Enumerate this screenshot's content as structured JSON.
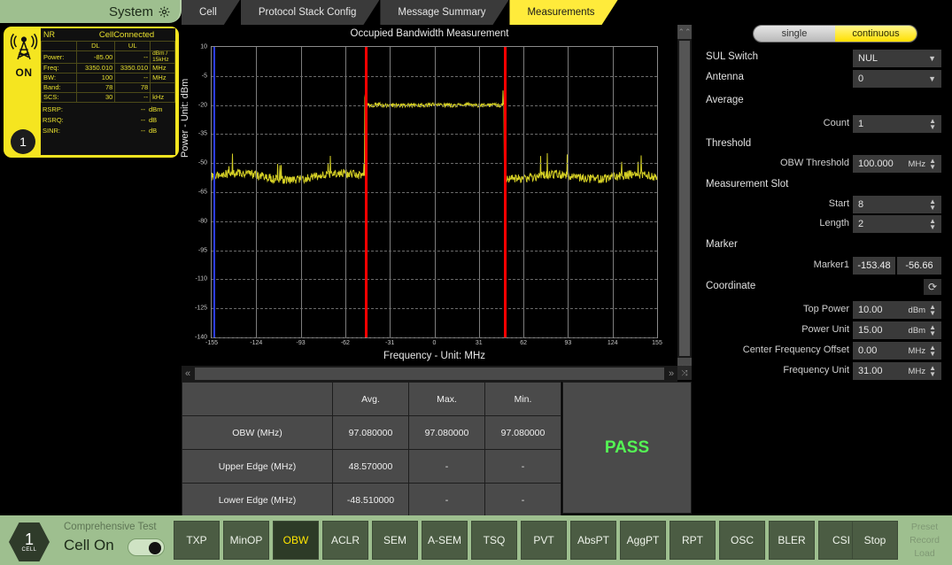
{
  "topbar": {
    "system_label": "System",
    "system_icon": "gear-icon",
    "tabs": [
      {
        "label": "Cell",
        "selected": false
      },
      {
        "label": "Protocol Stack Config",
        "selected": false
      },
      {
        "label": "Message Summary",
        "selected": false
      },
      {
        "label": "Measurements",
        "selected": true
      }
    ]
  },
  "nr_card": {
    "tower_icon": "cell-tower-icon",
    "on_label": "ON",
    "badge": "1",
    "tech": "NR",
    "state": "CellConnected",
    "col_dl": "DL",
    "col_ul": "UL",
    "rows": [
      {
        "name": "Power:",
        "dl": "-85.00",
        "ul": "--",
        "unit": "dBm / 15kHz"
      },
      {
        "name": "Freq:",
        "dl": "3350.010",
        "ul": "3350.010",
        "unit": "MHz"
      },
      {
        "name": "BW:",
        "dl": "100",
        "ul": "--",
        "unit": "MHz"
      },
      {
        "name": "Band:",
        "dl": "78",
        "ul": "78",
        "unit": ""
      },
      {
        "name": "SCS:",
        "dl": "30",
        "ul": "--",
        "unit": "kHz"
      }
    ],
    "footer": [
      {
        "name": "RSRP:",
        "value": "--",
        "unit": "dBm"
      },
      {
        "name": "RSRQ:",
        "value": "--",
        "unit": "dB"
      },
      {
        "name": "SINR:",
        "value": "--",
        "unit": "dB"
      }
    ]
  },
  "chart_data": {
    "type": "line",
    "title": "Occupied Bandwidth Measurement",
    "xlabel": "Frequency - Unit: MHz",
    "ylabel": "Power - Unit: dBm",
    "xlim": [
      -155,
      155
    ],
    "ylim": [
      -140,
      10
    ],
    "xticks": [
      -155,
      -124,
      -93,
      -62,
      -31,
      0,
      31,
      62,
      93,
      124,
      155
    ],
    "yticks": [
      10,
      -5,
      -20,
      -35,
      -50,
      -65,
      -80,
      -95,
      -110,
      -125,
      -140
    ],
    "grid": true,
    "legend": "none",
    "trace_color": "#d4cf25",
    "markers": [
      {
        "name": "lower-edge-marker",
        "x": -48.51,
        "color": "#ff0000"
      },
      {
        "name": "upper-edge-marker",
        "x": 48.57,
        "color": "#ff0000"
      },
      {
        "name": "marker1",
        "x": -153.48,
        "y": -56.66,
        "color": "#2b3cf0"
      }
    ],
    "series": [
      {
        "name": "Spectrum",
        "description": "Noise floor near -57 dBm outside band, flat in-band plateau near -20 dBm between -48.51 and 48.57 MHz",
        "noise_floor_dbm": -57,
        "in_band_dbm": -20,
        "band_start_mhz": -48.51,
        "band_stop_mhz": 48.57
      }
    ]
  },
  "results_table": {
    "headers": [
      "",
      "Avg.",
      "Max.",
      "Min."
    ],
    "rows": [
      {
        "label": "OBW (MHz)",
        "avg": "97.080000",
        "max": "97.080000",
        "min": "97.080000"
      },
      {
        "label": "Upper Edge (MHz)",
        "avg": "48.570000",
        "max": "-",
        "min": "-"
      },
      {
        "label": "Lower Edge (MHz)",
        "avg": "-48.510000",
        "max": "-",
        "min": "-"
      }
    ],
    "verdict": "PASS",
    "verdict_color": "#54f554"
  },
  "scrollbars": {
    "h_left_icon": "double-chevron-left-icon",
    "h_right_icon": "double-chevron-right-icon",
    "expand_icon": "collapse-icon",
    "v_up_icon": "double-chevron-up-icon",
    "v_down_icon": "double-chevron-down-icon"
  },
  "right_panel": {
    "mode_single": "single",
    "mode_continuous": "continuous",
    "mode_selected": "continuous",
    "sul_switch_label": "SUL Switch",
    "sul_switch_value": "NUL",
    "antenna_label": "Antenna",
    "antenna_value": "0",
    "average_section": "Average",
    "count_label": "Count",
    "count_value": "1",
    "threshold_section": "Threshold",
    "obw_threshold_label": "OBW Threshold",
    "obw_threshold_value": "100.000",
    "obw_threshold_unit": "MHz",
    "meas_slot_section": "Measurement Slot",
    "start_label": "Start",
    "start_value": "8",
    "length_label": "Length",
    "length_value": "2",
    "marker_section": "Marker",
    "marker1_label": "Marker1",
    "marker1_x": "-153.48",
    "marker1_y": "-56.66",
    "coordinate_section": "Coordinate",
    "refresh_icon": "refresh-icon",
    "top_power_label": "Top Power",
    "top_power_value": "10.00",
    "top_power_unit": "dBm",
    "power_unit_label": "Power Unit",
    "power_unit_value": "15.00",
    "power_unit_unit": "dBm",
    "cfo_label": "Center Frequency Offset",
    "cfo_value": "0.00",
    "cfo_unit": "MHz",
    "freq_unit_label": "Frequency Unit",
    "freq_unit_value": "31.00",
    "freq_unit_unit": "MHz"
  },
  "bottom_bar": {
    "cell_number": "1",
    "cell_caption": "CELL",
    "comprehensive_test": "Comprehensive Test",
    "cell_on_label": "Cell On",
    "cell_on_state": "on",
    "test_buttons": [
      {
        "label": "TXP",
        "active": false
      },
      {
        "label": "MinOP",
        "active": false
      },
      {
        "label": "OBW",
        "active": true
      },
      {
        "label": "ACLR",
        "active": false
      },
      {
        "label": "SEM",
        "active": false
      },
      {
        "label": "A-SEM",
        "active": false
      },
      {
        "label": "TSQ",
        "active": false
      },
      {
        "label": "PVT",
        "active": false
      },
      {
        "label": "AbsPT",
        "active": false
      },
      {
        "label": "AggPT",
        "active": false
      },
      {
        "label": "RPT",
        "active": false
      },
      {
        "label": "OSC",
        "active": false
      },
      {
        "label": "BLER",
        "active": false
      },
      {
        "label": "CSI",
        "active": false
      }
    ],
    "stop_label": "Stop",
    "preset": "Preset",
    "record": "Record",
    "load": "Load"
  }
}
